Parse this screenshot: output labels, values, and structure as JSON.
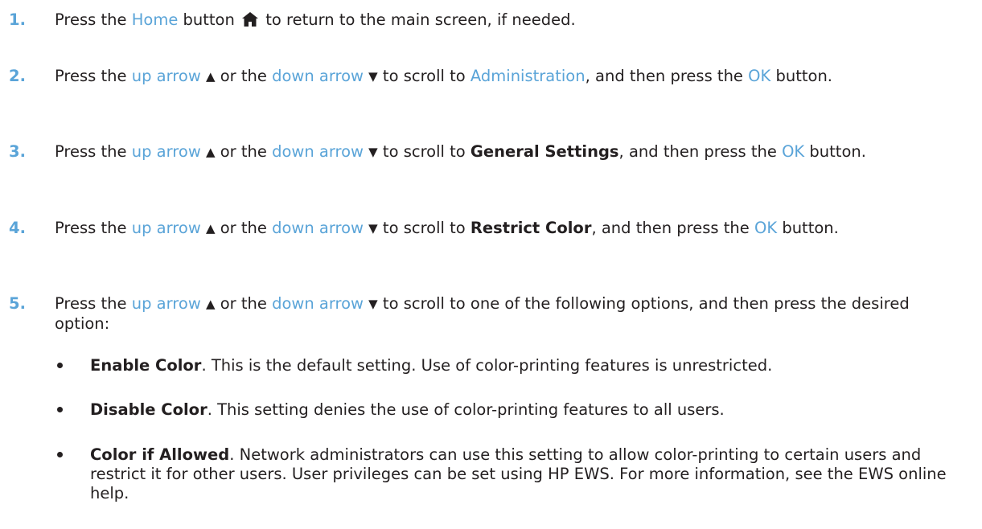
{
  "steps": [
    {
      "number": "1.",
      "t1": "Press the ",
      "home_label": "Home",
      "t2": " button ",
      "t3": " to return to the main screen, if needed."
    },
    {
      "number": "2.",
      "t1": "Press the ",
      "up": "up arrow",
      "up_glyph": "▲",
      "mid": " or the ",
      "down": "down arrow",
      "down_glyph": "▼",
      "t2": " to scroll to ",
      "target": "Administration",
      "t3": ", and then press the ",
      "ok": "OK",
      "t4": " button."
    },
    {
      "number": "3.",
      "t1": "Press the ",
      "up": "up arrow",
      "up_glyph": "▲",
      "mid": " or the ",
      "down": "down arrow",
      "down_glyph": "▼",
      "t2": " to scroll to ",
      "target": "General Settings",
      "t3": ", and then press the ",
      "ok": "OK",
      "t4": " button."
    },
    {
      "number": "4.",
      "t1": "Press the ",
      "up": "up arrow",
      "up_glyph": "▲",
      "mid": " or the ",
      "down": "down arrow",
      "down_glyph": "▼",
      "t2": " to scroll to ",
      "target": "Restrict Color",
      "t3": ", and then press the ",
      "ok": "OK",
      "t4": " button."
    },
    {
      "number": "5.",
      "t1": "Press the ",
      "up": "up arrow",
      "up_glyph": "▲",
      "mid": " or the ",
      "down": "down arrow",
      "down_glyph": "▼",
      "t2": " to scroll to one of the following options, and then press the desired option:"
    }
  ],
  "options": [
    {
      "name": "Enable Color",
      "desc": ". This is the default setting. Use of color-printing features is unrestricted."
    },
    {
      "name": "Disable Color",
      "desc": ". This setting denies the use of color-printing features to all users."
    },
    {
      "name": "Color if Allowed",
      "desc": ". Network administrators can use this setting to allow color-printing to certain users and restrict it for other users. User privileges can be set using HP EWS. For more information, see the EWS online help."
    }
  ],
  "icons": {
    "home": "home-icon",
    "bullet": "bullet-dot"
  },
  "colors": {
    "accent": "#5aa4d8",
    "text": "#231f20"
  }
}
